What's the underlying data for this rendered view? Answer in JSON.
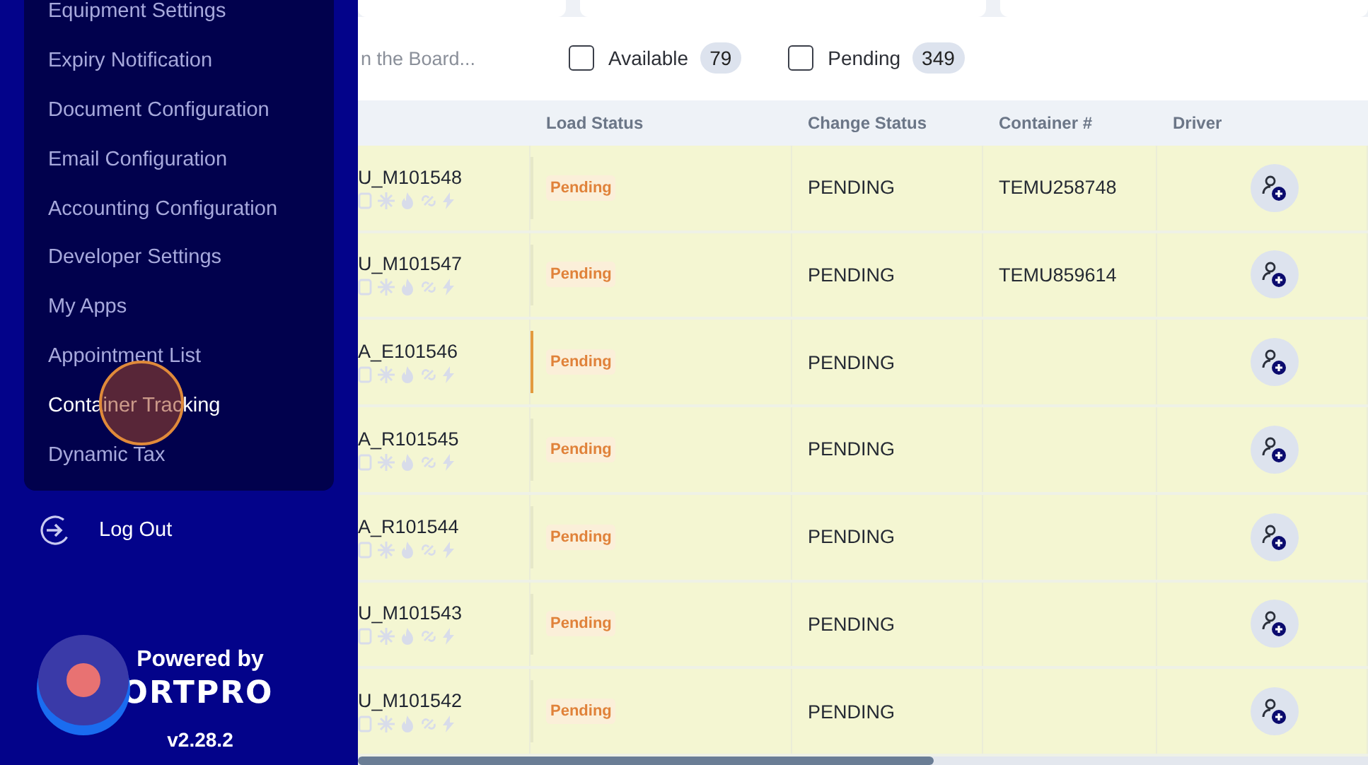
{
  "sidebar": {
    "submenu": [
      {
        "label": "Equipment Settings",
        "selected": false
      },
      {
        "label": "Expiry Notification",
        "selected": false
      },
      {
        "label": "Document Configuration",
        "selected": false
      },
      {
        "label": "Email Configuration",
        "selected": false
      },
      {
        "label": "Accounting Configuration",
        "selected": false
      },
      {
        "label": "Developer Settings",
        "selected": false
      },
      {
        "label": "My Apps",
        "selected": false
      },
      {
        "label": "Appointment List",
        "selected": false
      },
      {
        "label": "Container Tracking",
        "selected": true
      },
      {
        "label": "Dynamic Tax",
        "selected": false
      }
    ],
    "logout": "Log Out",
    "powered_by": "Powered by",
    "logo": "ORTPRO",
    "version": "v2.28.2"
  },
  "filters": {
    "search": {
      "placeholder": "n the Board..."
    },
    "checks": [
      {
        "label": "Available",
        "count": "79",
        "checked": false
      },
      {
        "label": "Pending",
        "count": "349",
        "checked": false
      }
    ]
  },
  "table": {
    "columns": [
      "Load Status",
      "Change Status",
      "Container #",
      "Driver"
    ],
    "rows": [
      {
        "load": "U_M101548",
        "load_status": "Pending",
        "change_status": "PENDING",
        "container": "TEMU258748",
        "selected": false
      },
      {
        "load": "U_M101547",
        "load_status": "Pending",
        "change_status": "PENDING",
        "container": "TEMU859614",
        "selected": false
      },
      {
        "load": "A_E101546",
        "load_status": "Pending",
        "change_status": "PENDING",
        "selected": true
      },
      {
        "load": "A_R101545",
        "load_status": "Pending",
        "change_status": "PENDING",
        "selected": false
      },
      {
        "load": "A_R101544",
        "load_status": "Pending",
        "change_status": "PENDING",
        "selected": false
      },
      {
        "load": "U_M101543",
        "load_status": "Pending",
        "change_status": "PENDING",
        "selected": false
      },
      {
        "load": "U_M101542",
        "load_status": "Pending",
        "change_status": "PENDING",
        "selected": false
      }
    ]
  }
}
